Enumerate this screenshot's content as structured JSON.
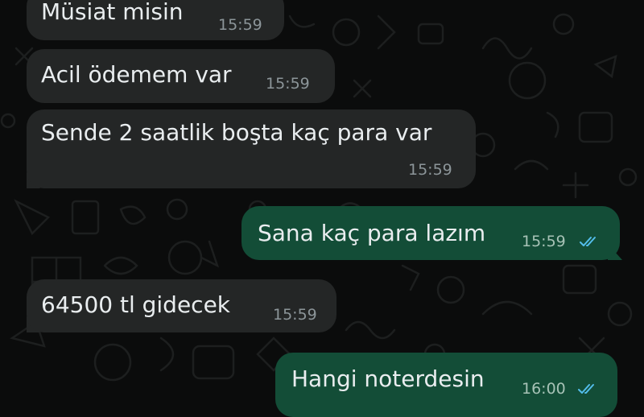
{
  "chat": {
    "messages": [
      {
        "direction": "incoming",
        "text": "Müsiat misin",
        "time": "15:59"
      },
      {
        "direction": "incoming",
        "text": "Acil ödemem var",
        "time": "15:59"
      },
      {
        "direction": "incoming",
        "text": "Sende 2 saatlik boşta kaç para var",
        "time": "15:59"
      },
      {
        "direction": "outgoing",
        "text": "Sana kaç para lazım",
        "time": "15:59",
        "status": "read"
      },
      {
        "direction": "incoming",
        "text": "64500 tl gidecek",
        "time": "15:59"
      },
      {
        "direction": "outgoing",
        "text": "Hangi noterdesin",
        "time": "16:00",
        "status": "read"
      }
    ]
  },
  "colors": {
    "background": "#0b0c0c",
    "incoming_bubble": "#242626",
    "outgoing_bubble": "#134d37",
    "read_ticks": "#53bdeb"
  },
  "icons": {
    "read_receipt": "double-check-icon"
  }
}
